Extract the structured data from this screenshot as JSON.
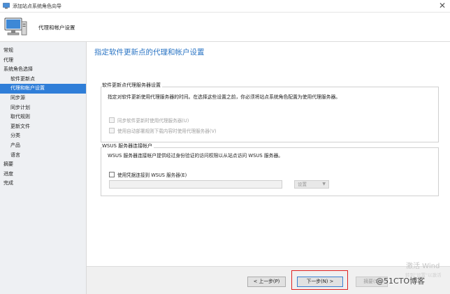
{
  "window": {
    "title": "添加站点系统角色向导",
    "close": "✕"
  },
  "header": {
    "step_title": "代理和帐户设置"
  },
  "sidebar": {
    "items": [
      {
        "label": "常规",
        "level": 0,
        "active": false
      },
      {
        "label": "代理",
        "level": 0,
        "active": false
      },
      {
        "label": "系统角色选择",
        "level": 0,
        "active": false
      },
      {
        "label": "软件更新点",
        "level": 1,
        "active": false
      },
      {
        "label": "代理和帐户设置",
        "level": 1,
        "active": true
      },
      {
        "label": "同步源",
        "level": 1,
        "active": false
      },
      {
        "label": "同步计划",
        "level": 1,
        "active": false
      },
      {
        "label": "取代规则",
        "level": 1,
        "active": false
      },
      {
        "label": "更新文件",
        "level": 1,
        "active": false
      },
      {
        "label": "分类",
        "level": 1,
        "active": false
      },
      {
        "label": "产品",
        "level": 1,
        "active": false
      },
      {
        "label": "语言",
        "level": 1,
        "active": false
      },
      {
        "label": "摘要",
        "level": 0,
        "active": false
      },
      {
        "label": "进度",
        "level": 0,
        "active": false
      },
      {
        "label": "完成",
        "level": 0,
        "active": false
      }
    ]
  },
  "main": {
    "page_title": "指定软件更新点的代理和帐户设置",
    "proxy_group": {
      "label": "软件更新点代理服务器设置",
      "description": "指定对软件更新使用代理服务器的时间。在选择这些设置之前，你必须将站点系统角色配置为使用代理服务器。",
      "options": [
        {
          "label": "同步软件更新时使用代理服务器(U)",
          "checked": false,
          "enabled": false
        },
        {
          "label": "使用自动部署规则下载内容时使用代理服务器(V)",
          "checked": false,
          "enabled": false
        }
      ]
    },
    "wsus_group": {
      "label": "WSUS 服务器连接帐户",
      "description": "WSUS 服务器连接帐户提供经过身份验证的访问权限以从站点访问 WSUS 服务器。",
      "checkbox_label": "使用凭据连接到 WSUS 服务器(E)",
      "account_value": "",
      "settings_label": "设置"
    }
  },
  "footer": {
    "prev_label": "< 上一步(P)",
    "next_label": "下一步(N) >",
    "summary_label": "摘要(S)"
  },
  "watermark": {
    "activate": "激活 Wind",
    "activate_sub": "转到\"设置\"以激活",
    "blog": "@51CTO博客"
  }
}
